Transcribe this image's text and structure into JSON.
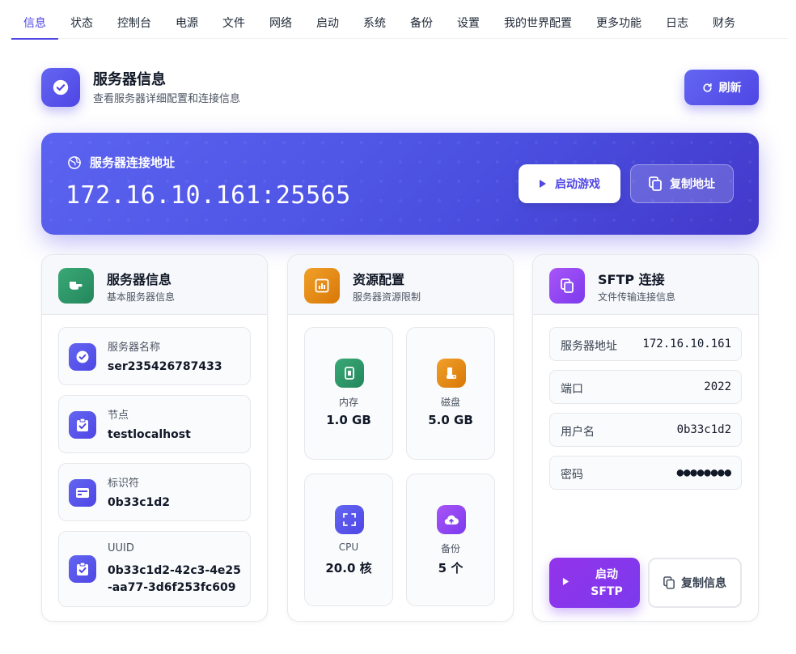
{
  "tabs": [
    "信息",
    "状态",
    "控制台",
    "电源",
    "文件",
    "网络",
    "启动",
    "系统",
    "备份",
    "设置",
    "我的世界配置",
    "更多功能",
    "日志",
    "财务"
  ],
  "header": {
    "title": "服务器信息",
    "subtitle": "查看服务器详细配置和连接信息",
    "refresh_label": "刷新"
  },
  "banner": {
    "label": "服务器连接地址",
    "address": "172.16.10.161:25565",
    "play_label": "启动游戏",
    "copy_label": "复制地址"
  },
  "server_info": {
    "title": "服务器信息",
    "subtitle": "基本服务器信息",
    "items": [
      {
        "label": "服务器名称",
        "value": "ser235426787433",
        "icon": "check-badge-icon"
      },
      {
        "label": "节点",
        "value": "testlocalhost",
        "icon": "clipboard-check-icon"
      },
      {
        "label": "标识符",
        "value": "0b33c1d2",
        "icon": "id-card-icon"
      },
      {
        "label": "UUID",
        "value": "0b33c1d2-42c3-4e25-aa77-3d6f253fc609",
        "icon": "clipboard-check-icon"
      }
    ]
  },
  "resources": {
    "title": "资源配置",
    "subtitle": "服务器资源限制",
    "tiles": [
      {
        "label": "内存",
        "value": "1.0 GB",
        "icon": "memory-icon"
      },
      {
        "label": "磁盘",
        "value": "5.0 GB",
        "icon": "disk-icon"
      },
      {
        "label": "CPU",
        "value": "20.0 核",
        "icon": "cpu-icon"
      },
      {
        "label": "备份",
        "value": "5 个",
        "icon": "cloud-upload-icon"
      }
    ]
  },
  "sftp": {
    "title": "SFTP 连接",
    "subtitle": "文件传输连接信息",
    "rows": [
      {
        "label": "服务器地址",
        "value": "172.16.10.161"
      },
      {
        "label": "端口",
        "value": "2022"
      },
      {
        "label": "用户名",
        "value": "0b33c1d2"
      },
      {
        "label": "密码",
        "value": "●●●●●●●●"
      }
    ],
    "start_label_1": "启动",
    "start_label_2": "SFTP",
    "copy_label": "复制信息"
  },
  "colors": {
    "primary": "#4f46e5",
    "green": "#23875c",
    "orange": "#d97706",
    "purple": "#7c3aed"
  }
}
